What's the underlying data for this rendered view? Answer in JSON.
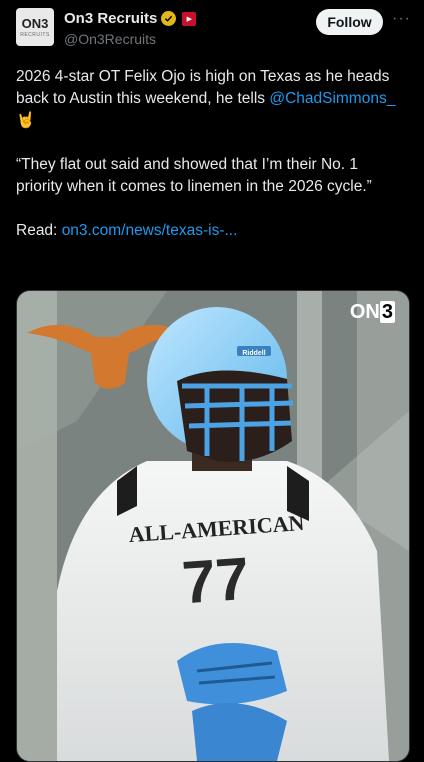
{
  "account": {
    "display_name": "On3 Recruits",
    "handle": "@On3Recruits",
    "avatar_text": "ON3",
    "avatar_subtext": "RECRUITS",
    "follow_label": "Follow",
    "more_glyph": "···"
  },
  "tweet": {
    "line1": "2026 4-star OT Felix Ojo is high on Texas as he heads back to Austin this weekend, he tells",
    "mention": "@ChadSimmons_",
    "emoji": "🤘",
    "quote": "“They flat out said and showed that I’m their No. 1 priority when it comes to linemen in the 2026 cycle.”",
    "read_label": "Read:",
    "read_link": "on3.com/news/texas-is-..."
  },
  "media": {
    "brand_on": "ON",
    "brand_3": "3",
    "helmet_text": "Riddell",
    "jersey_text": "ALL-AMERICAN",
    "jersey_number": "77"
  },
  "colors": {
    "accent": "#1d9bf0",
    "longhorn": "#d2782f",
    "verified": "#e2b719"
  }
}
